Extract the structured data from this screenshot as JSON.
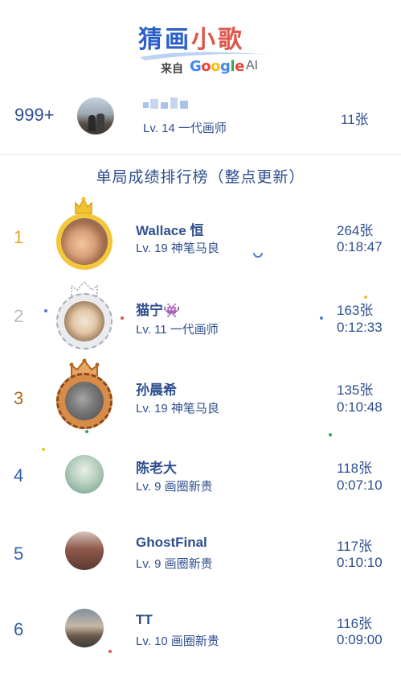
{
  "logo": {
    "title_blue": "猜画",
    "title_red": "小歌",
    "from": "来自",
    "google_letters": [
      "G",
      "o",
      "o",
      "g",
      "l",
      "e"
    ],
    "ai": "AI"
  },
  "me": {
    "rank": "999+",
    "level": "Lv. 14 一代画师",
    "count": "11张"
  },
  "leaderboard": {
    "title": "单局成绩排行榜（整点更新）",
    "rows": [
      {
        "rank": "1",
        "name": "Wallace 恒",
        "level": "Lv. 19 神笔马良",
        "count": "264张",
        "time": "0:18:47"
      },
      {
        "rank": "2",
        "name": "猫宁👾",
        "level": "Lv. 11 一代画师",
        "count": "163张",
        "time": "0:12:33"
      },
      {
        "rank": "3",
        "name": "孙晨希",
        "level": "Lv. 19 神笔马良",
        "count": "135张",
        "time": "0:10:48"
      },
      {
        "rank": "4",
        "name": "陈老大",
        "level": "Lv. 9 画圈新贵",
        "count": "118张",
        "time": "0:07:10"
      },
      {
        "rank": "5",
        "name": "GhostFinal",
        "level": "Lv. 9 画圈新贵",
        "count": "117张",
        "time": "0:10:10"
      },
      {
        "rank": "6",
        "name": "TT",
        "level": "Lv. 10 画圈新贵",
        "count": "116张",
        "time": "0:09:00"
      }
    ]
  },
  "colors": {
    "gold": "#e8a82a",
    "silver": "#b8bcc4",
    "bronze": "#b5651d",
    "navy": "#2f4f8f",
    "rank_blue": "#2f5fa8"
  }
}
